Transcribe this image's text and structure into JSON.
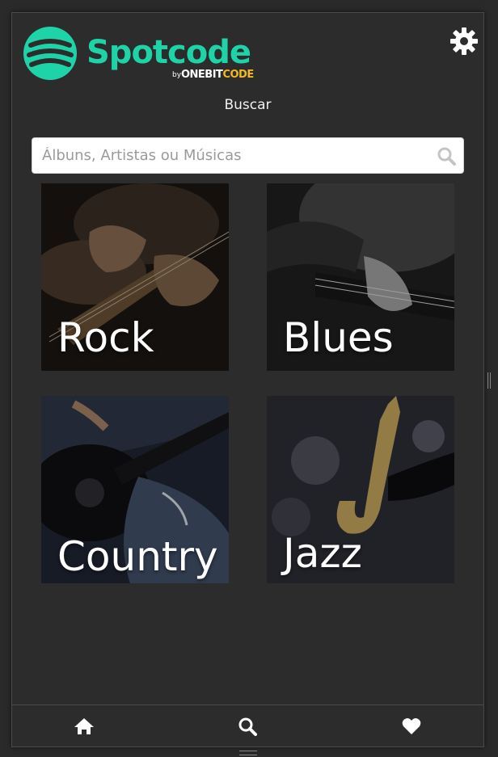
{
  "brand": {
    "name": "Spotcode",
    "by": "by",
    "maker_prefix": "ONEBIT",
    "maker_suffix": "CODE",
    "accent": "#1ed3a8",
    "maker_accent": "#f2b824"
  },
  "header": {
    "settings_icon": "gear-icon"
  },
  "page": {
    "title": "Buscar"
  },
  "search": {
    "placeholder": "Álbuns, Artistas ou Músicas",
    "value": "",
    "icon": "search-icon"
  },
  "genres": [
    {
      "label": "Rock"
    },
    {
      "label": "Blues"
    },
    {
      "label": "Country"
    },
    {
      "label": "Jazz"
    }
  ],
  "bottom_nav": {
    "items": [
      {
        "icon": "home-icon"
      },
      {
        "icon": "search-icon"
      },
      {
        "icon": "heart-icon"
      }
    ]
  }
}
